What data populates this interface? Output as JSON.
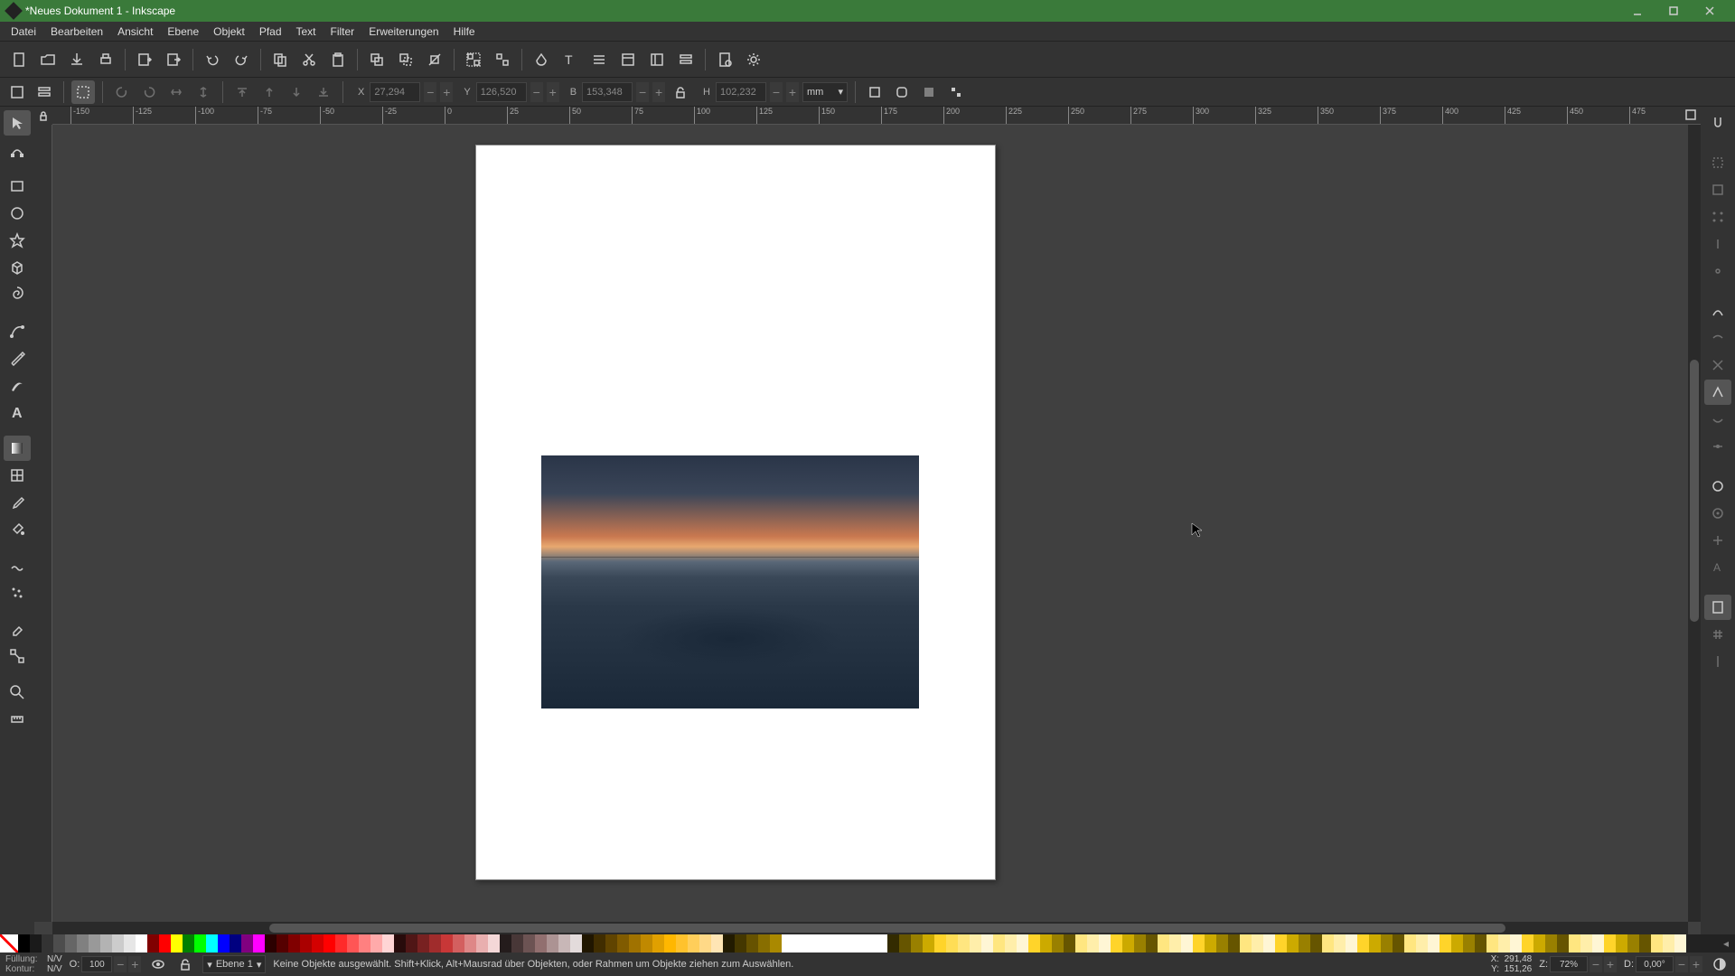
{
  "title": "*Neues Dokument 1 - Inkscape",
  "menu": [
    "Datei",
    "Bearbeiten",
    "Ansicht",
    "Ebene",
    "Objekt",
    "Pfad",
    "Text",
    "Filter",
    "Erweiterungen",
    "Hilfe"
  ],
  "ctx": {
    "x_label": "X",
    "x_value": "27,294",
    "y_label": "Y",
    "y_value": "126,520",
    "w_label": "B",
    "w_value": "153,348",
    "h_label": "H",
    "h_value": "102,232",
    "unit": "mm"
  },
  "ruler_x": [
    "-150",
    "-125",
    "-100",
    "-75",
    "-50",
    "-25",
    "0",
    "25",
    "50",
    "75",
    "100",
    "125",
    "150",
    "175",
    "200",
    "225",
    "250",
    "275",
    "300",
    "325",
    "350",
    "375",
    "400",
    "425",
    "450",
    "475"
  ],
  "palette_grays": [
    "#000000",
    "#1a1a1a",
    "#333333",
    "#4d4d4d",
    "#666666",
    "#808080",
    "#999999",
    "#b3b3b3",
    "#cccccc",
    "#e6e6e6",
    "#ffffff"
  ],
  "palette_basic": [
    "#800000",
    "#ff0000",
    "#ffff00",
    "#008000",
    "#00ff00",
    "#00ffff",
    "#0000ff",
    "#000080",
    "#800080",
    "#ff00ff"
  ],
  "palette_reds": [
    "#2b0000",
    "#550000",
    "#800000",
    "#aa0000",
    "#d40000",
    "#ff0000",
    "#ff2a2a",
    "#ff5555",
    "#ff8080",
    "#ffaaaa",
    "#ffd5d5"
  ],
  "palette_maroon": [
    "#280b0b",
    "#501616",
    "#782121",
    "#a02c2c",
    "#c83737",
    "#d35f5f",
    "#de8787",
    "#e9afaf",
    "#f4d7d7"
  ],
  "palette_orange": [
    "#241c1c",
    "#483737",
    "#6c5353",
    "#916f6f",
    "#ac9393",
    "#c8b7b7",
    "#e3dbdb",
    "#201600",
    "#402d00",
    "#604400",
    "#805b00",
    "#a07200",
    "#c08900",
    "#e0a000",
    "#ffb700",
    "#ffc22d",
    "#ffce5a",
    "#ffd987",
    "#ffe5b4"
  ],
  "palette_blank": [
    "#221b00",
    "#443700",
    "#665200",
    "#886e00",
    "#aa8900"
  ],
  "palette_yellow": [
    "#332b00",
    "#665500",
    "#998000",
    "#ccaa00",
    "#ffd42a",
    "#ffdd55",
    "#ffe680",
    "#ffeeaa",
    "#fff6d5"
  ],
  "status": {
    "fill_label": "Füllung:",
    "fill_value": "N/V",
    "stroke_label": "Kontur:",
    "stroke_value": "N/V",
    "opacity_label": "O:",
    "opacity_value": "100",
    "layer": "Ebene 1",
    "message": "Keine Objekte ausgewählt. Shift+Klick, Alt+Mausrad über Objekten, oder Rahmen um Objekte ziehen zum Auswählen.",
    "coord_x_label": "X:",
    "coord_x": "291,48",
    "coord_y_label": "Y:",
    "coord_y": "151,26",
    "zoom_label": "Z:",
    "zoom": "72%",
    "rot_label": "D:",
    "rot": "0,00°"
  }
}
